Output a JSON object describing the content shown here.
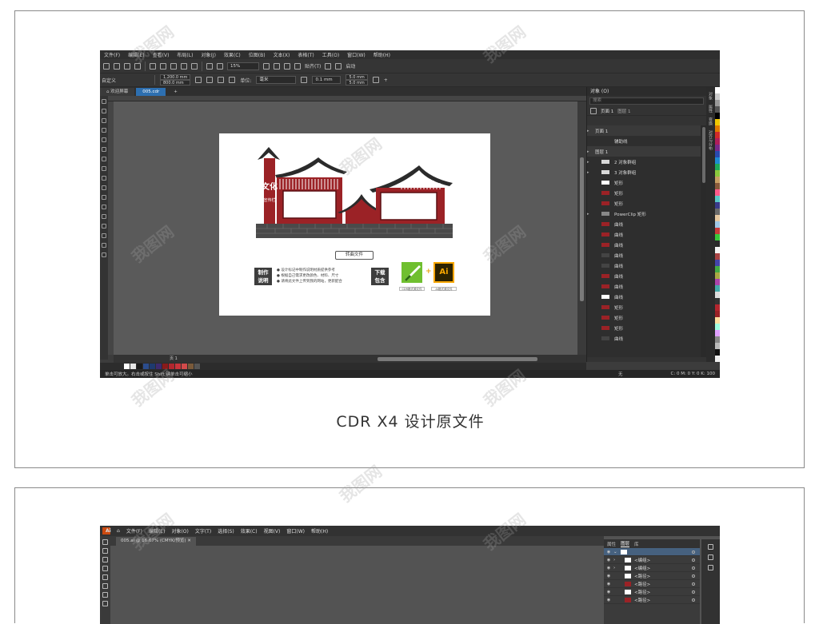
{
  "cdr": {
    "menu": [
      "文件(F)",
      "编辑(E)",
      "查看(V)",
      "布局(L)",
      "对象(J)",
      "效果(C)",
      "位图(B)",
      "文本(X)",
      "表格(T)",
      "工具(O)",
      "窗口(W)",
      "帮助(H)"
    ],
    "toolbar1": {
      "zoom": "15%",
      "snap": "贴齐(T)",
      "launch": "启动"
    },
    "toolbar2": {
      "preset": "自定义",
      "width": "1,200.0 mm",
      "height": "800.0 mm",
      "units_label": "单位:",
      "units_value": "毫米",
      "nudge": "0.1 mm",
      "dup_x": "5.0 mm",
      "dup_y": "5.0 mm"
    },
    "tabs": [
      "欢迎屏幕",
      "005.cdr"
    ],
    "document": {
      "sign_title": "文化",
      "sign_subtitle": "宣传栏",
      "button": "转曲文件",
      "box_make": "制作\n说明",
      "box_download": "下载\n包含",
      "notes": [
        "设计标记中制作说明材质提供参考",
        "根据自己需求更改颜色、材料、尺寸",
        "请将此文件上传到我的网站，更新配合"
      ],
      "app_cdr_caption": "CDR格式源文件",
      "app_ai_caption": "AI格式源文件",
      "app_ai_label": "Ai",
      "plus": "+"
    },
    "panel": {
      "title": "对象",
      "search": "搜索",
      "page_label": "页面 1",
      "layer_label": "图层 1",
      "rows": [
        {
          "label": "页面 1",
          "kind": "header",
          "color": ""
        },
        {
          "label": "辅助线",
          "kind": "item",
          "color": ""
        },
        {
          "label": "图层 1",
          "kind": "header",
          "color": ""
        },
        {
          "label": "2 对象群组",
          "kind": "group",
          "color": "#d8d8d8"
        },
        {
          "label": "3 对象群组",
          "kind": "group",
          "color": "#d8d8d8"
        },
        {
          "label": "矩形",
          "kind": "item",
          "color": "#ffffff"
        },
        {
          "label": "矩形",
          "kind": "item",
          "color": "#9b2226"
        },
        {
          "label": "矩形",
          "kind": "item",
          "color": "#9b2226"
        },
        {
          "label": "PowerClip 矩形",
          "kind": "group",
          "color": "#888888"
        },
        {
          "label": "曲线",
          "kind": "item",
          "color": "#9b2226"
        },
        {
          "label": "曲线",
          "kind": "item",
          "color": "#9b2226"
        },
        {
          "label": "曲线",
          "kind": "item",
          "color": "#9b2226"
        },
        {
          "label": "曲线",
          "kind": "item",
          "color": "#444444"
        },
        {
          "label": "曲线",
          "kind": "item",
          "color": "#444444"
        },
        {
          "label": "曲线",
          "kind": "item",
          "color": "#9b2226"
        },
        {
          "label": "曲线",
          "kind": "item",
          "color": "#9b2226"
        },
        {
          "label": "曲线",
          "kind": "item",
          "color": "#ffffff"
        },
        {
          "label": "矩形",
          "kind": "item",
          "color": "#9b2226"
        },
        {
          "label": "矩形",
          "kind": "item",
          "color": "#9b2226"
        },
        {
          "label": "矩形",
          "kind": "item",
          "color": "#9b2226"
        },
        {
          "label": "曲线",
          "kind": "item",
          "color": "#444444"
        }
      ],
      "dock_tabs": [
        "对象",
        "属性",
        "变换",
        "对齐与分布"
      ]
    },
    "page_tab": "页 1",
    "status_left": "单击可放大。右击或按住 Shift 键单击可缩小",
    "status_fill": "无",
    "status_color": "C: 0 M: 0 Y: 0 K: 100"
  },
  "caption1": "CDR X4 设计原文件",
  "ai": {
    "menu": [
      "文件(F)",
      "编辑(E)",
      "对象(O)",
      "文字(T)",
      "选择(S)",
      "效果(C)",
      "视图(V)",
      "窗口(W)",
      "帮助(H)"
    ],
    "logo": "Ai",
    "tab": "005.ai @ 16.67% (CMYK/预览)",
    "panel_tabs": [
      "属性",
      "图层",
      "库"
    ],
    "rows": [
      "<编组>",
      "<编组>",
      "<路径>",
      "<路径>",
      "<路径>",
      "<路径>"
    ]
  },
  "watermark": "我图网",
  "colors": {
    "accent_red": "#9b2226",
    "dark": "#2b2b2b",
    "selection_blue": "#2d6fb0"
  }
}
